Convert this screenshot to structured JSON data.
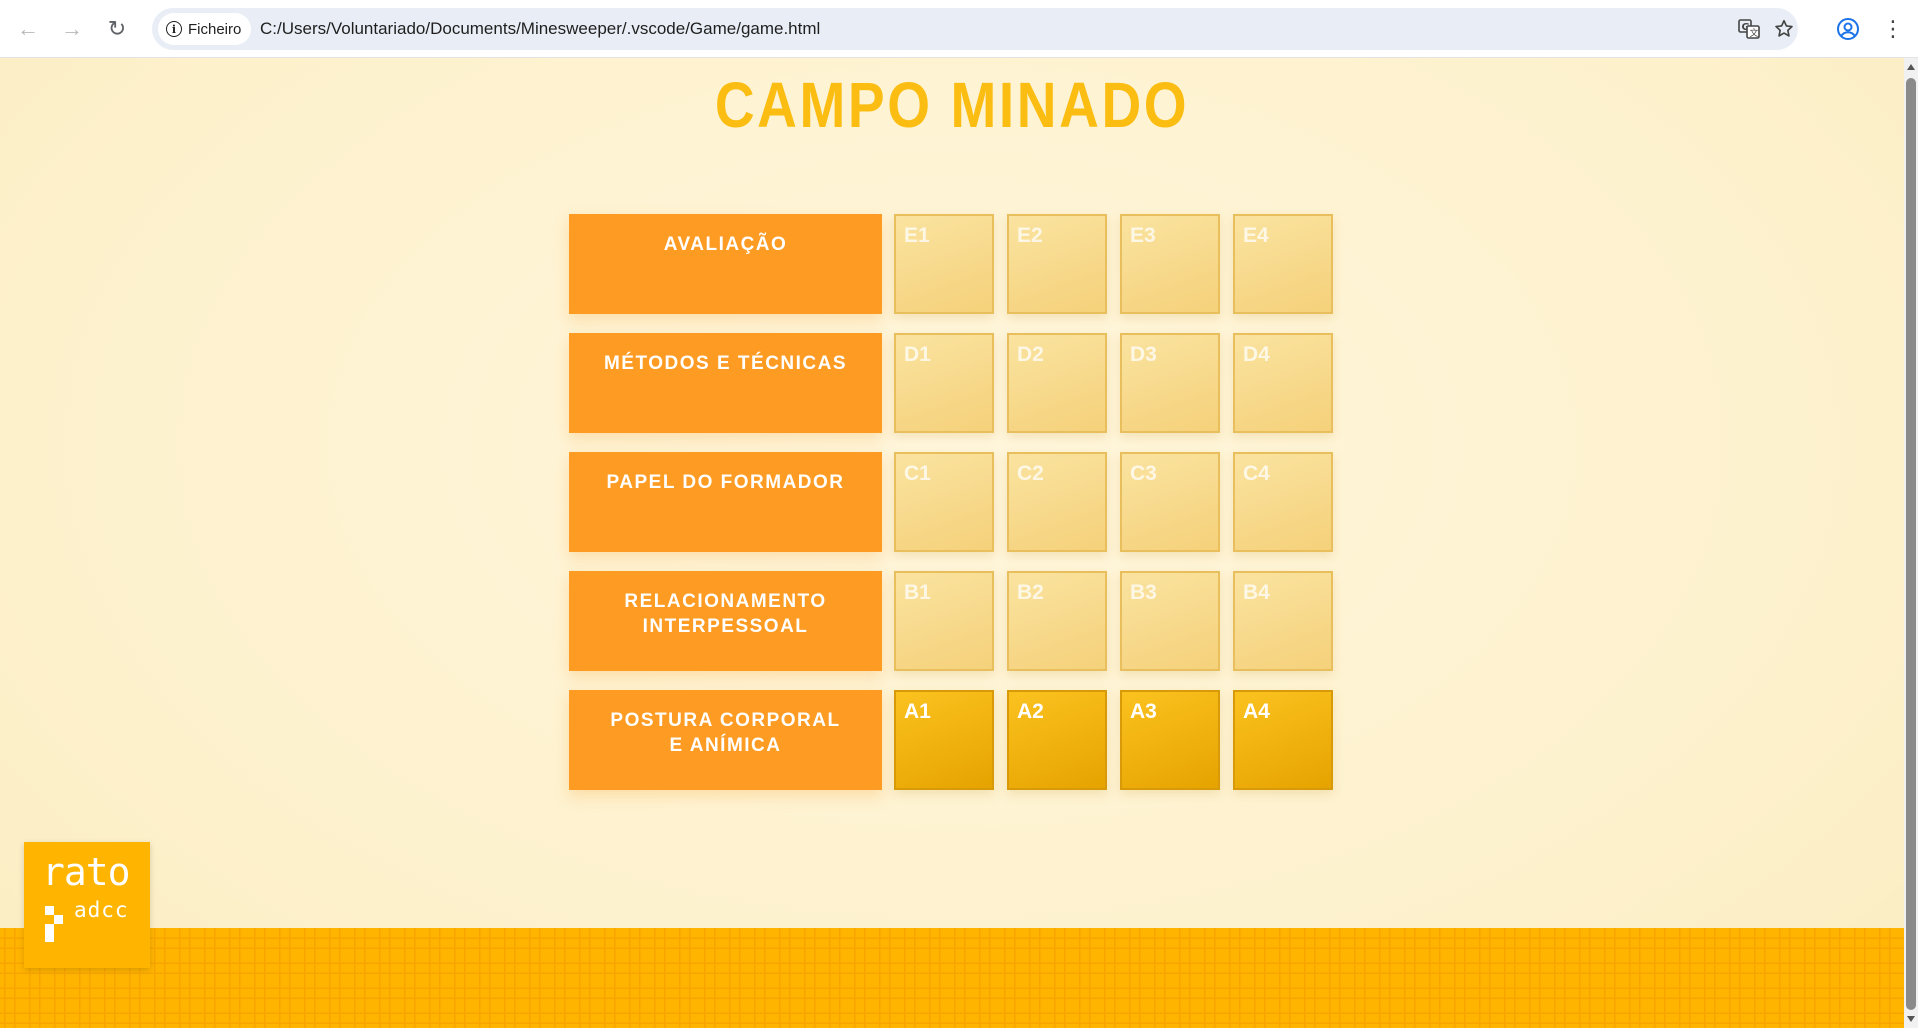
{
  "browser": {
    "back_icon": "←",
    "forward_icon": "→",
    "reload_icon": "↻",
    "chip_label": "Ficheiro",
    "url": "C:/Users/Voluntariado/Documents/Minesweeper/.vscode/Game/game.html",
    "menu_icon": "⋮"
  },
  "game": {
    "title": "CAMPO MINADO",
    "rows": [
      {
        "category": "AVALIAÇÃO",
        "cells": [
          "E1",
          "E2",
          "E3",
          "E4"
        ],
        "active": false
      },
      {
        "category": "MÉTODOS E TÉCNICAS",
        "cells": [
          "D1",
          "D2",
          "D3",
          "D4"
        ],
        "active": false
      },
      {
        "category": "PAPEL DO FORMADOR",
        "cells": [
          "C1",
          "C2",
          "C3",
          "C4"
        ],
        "active": false
      },
      {
        "category": "RELACIONAMENTO\nINTERPESSOAL",
        "cells": [
          "B1",
          "B2",
          "B3",
          "B4"
        ],
        "active": false
      },
      {
        "category": "POSTURA CORPORAL\nE ANÍMICA",
        "cells": [
          "A1",
          "A2",
          "A3",
          "A4"
        ],
        "active": true
      }
    ]
  },
  "logo": {
    "word1": "rato",
    "word2": "adcc"
  },
  "colors": {
    "title": "#fbbd12",
    "category_bg": "#fd9b23",
    "cell_inactive": "#f7d888",
    "cell_active": "#f5b40f",
    "footer": "#ffb400"
  }
}
